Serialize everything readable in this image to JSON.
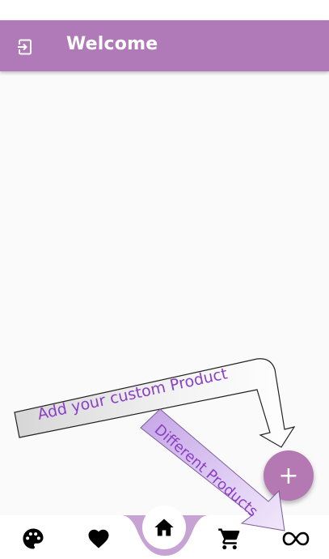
{
  "appbar": {
    "title": "Welcome",
    "leading_icon": "logout-icon",
    "color": "#b07ab8"
  },
  "annotations": {
    "add_product_text": "Add your custom Product",
    "different_products_text": "Different Products",
    "text_color": "#8a3fc4"
  },
  "fab": {
    "icon": "plus-icon",
    "label": "+",
    "color": "#b478b2"
  },
  "bottom_nav": {
    "items": [
      {
        "icon": "palette-icon"
      },
      {
        "icon": "heart-icon"
      },
      {
        "icon": "home-icon",
        "selected": true
      },
      {
        "icon": "cart-icon"
      },
      {
        "icon": "infinity-icon"
      }
    ],
    "accent": "#c7a3d4"
  }
}
